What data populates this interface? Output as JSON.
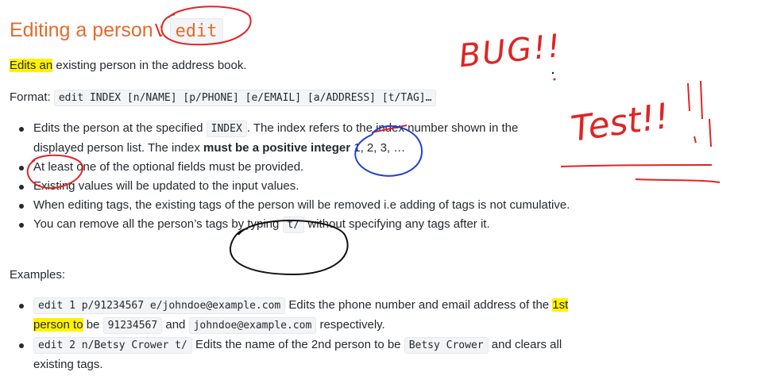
{
  "heading": {
    "text": "Editing a person : ",
    "code": "edit"
  },
  "intro": {
    "highlighted": "Edits an",
    "rest": " existing person in the address book."
  },
  "format": {
    "label": "Format: ",
    "code": "edit INDEX [n/NAME] [p/PHONE] [e/EMAIL] [a/ADDRESS] [t/TAG]…"
  },
  "bullets": [
    {
      "text_before": "Edits the person at the specified ",
      "code": "INDEX",
      "text_after": ". The index refers to the index number shown in the displayed person list. The index ",
      "bold": "must be a positive integer",
      "text_end": " 1, 2, 3, …"
    },
    {
      "text": "At least one of the optional fields must be provided."
    },
    {
      "text": "Existing values will be updated to the input values."
    },
    {
      "text": "When editing tags, the existing tags of the person will be removed i.e adding of tags is not cumulative."
    },
    {
      "text_before": "You can remove all the person’s tags by typing ",
      "code": "t/",
      "text_after": " without specifying any tags after it."
    }
  ],
  "examples_label": "Examples:",
  "examples": [
    {
      "code": "edit 1 p/91234567 e/johndoe@example.com",
      "text1": " Edits the phone number and email address of the ",
      "highlighted": "1st person to",
      "text2": " be ",
      "code2": "91234567",
      "text3": " and ",
      "code3": "johndoe@example.com",
      "text4": " respectively."
    },
    {
      "code": "edit 2 n/Betsy Crower t/",
      "text1": " Edits the name of the 2nd person to be ",
      "code2": "Betsy Crower",
      "text2": " and clears all existing tags."
    }
  ],
  "annotations": {
    "bug_text": "BUG!!",
    "test_text": "Test!!",
    "ink_red": "#e02424",
    "ink_blue": "#1f3fd6",
    "ink_black": "#111111",
    "highlight_yellow": "#fff200"
  }
}
